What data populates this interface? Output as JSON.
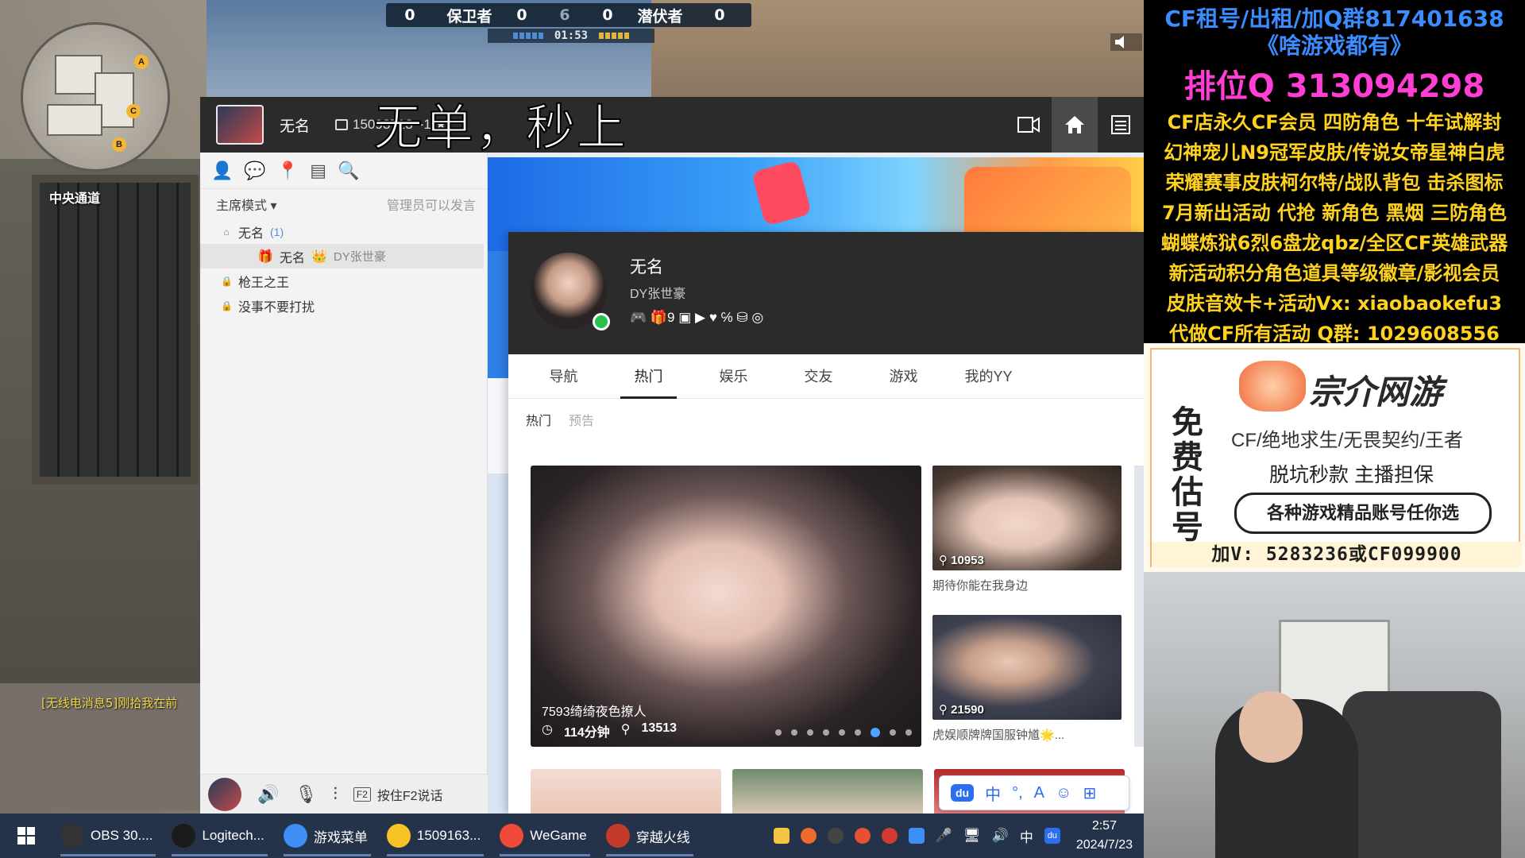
{
  "game": {
    "minimap_location": "中央通道",
    "minimap_markers": [
      "A",
      "B",
      "C"
    ],
    "killfeed": "[无线电消息5]刚拾我在前",
    "scoreboard": {
      "left_kills": "0",
      "left_team": "保卫者",
      "left_score": "0",
      "round": "6",
      "right_score": "0",
      "right_team": "潜伏者",
      "right_kills": "0"
    },
    "timer": "01:53"
  },
  "caption": "无单，秒上",
  "yy": {
    "username": "无名",
    "id_label": "15093713",
    "header_stats": "-1 ★",
    "channel": {
      "mode": "主席模式 ▾",
      "hint": "管理员可以发言",
      "tree": [
        {
          "name": "无名",
          "count": "(1)"
        },
        {
          "name": "无名",
          "tag": "DY张世豪"
        },
        {
          "name": "枪王之王"
        },
        {
          "name": "没事不要打扰"
        }
      ]
    },
    "voice_hint": "按住F2说话",
    "voice_key": "F2",
    "profile": {
      "name": "无名",
      "sub": "DY张世豪",
      "badges": "🎮 🎁9 ▣ ▶ ♥ ℅ ⛁ ◎"
    },
    "nav_tabs": [
      "导航",
      "热门",
      "娱乐",
      "交友",
      "游戏",
      "我的YY"
    ],
    "active_tab": "热门",
    "sub_tabs": [
      "热门",
      "预告"
    ],
    "feature": {
      "title": "7593绮绮夜色撩人",
      "duration": "114分钟",
      "viewers": "13513",
      "dots": 9,
      "current_dot": 6
    },
    "side_cards": [
      {
        "viewers": "10953",
        "caption": "期待你能在我身边"
      },
      {
        "viewers": "21590",
        "caption": "虎娱顺牌牌国服钟馗🌟..."
      }
    ]
  },
  "ad": {
    "lines": [
      {
        "text": "CF租号/出租/加Q群817401638",
        "color": "#3a8cff"
      },
      {
        "text": "《啥游戏都有》",
        "color": "#3a8cff"
      },
      {
        "text": "排位Q 313094298",
        "color": "#ff3ed6"
      },
      {
        "text": "CF店永久CF会员 四防角色 十年试解封",
        "color": "#ffd21f"
      },
      {
        "text": "幻神宠儿N9冠军皮肤/传说女帝星神白虎",
        "color": "#ffd21f"
      },
      {
        "text": "荣耀赛事皮肤柯尔特/战队背包 击杀图标",
        "color": "#ffd21f"
      },
      {
        "text": "7月新出活动 代抢 新角色 黑烟 三防角色",
        "color": "#ffd21f"
      },
      {
        "text": "蝴蝶炼狱6烈6盘龙qbz/全区CF英雄武器",
        "color": "#ffd21f"
      },
      {
        "text": "新活动积分角色道具等级徽章/影视会员",
        "color": "#ffd21f"
      },
      {
        "text": "皮肤音效卡+活动Vx: xiaobaokefu3",
        "color": "#ffd21f"
      },
      {
        "text": "代做CF所有活动 Q群: 1029608556",
        "color": "#ffd21f"
      }
    ]
  },
  "promo": {
    "side_text": "免费估号",
    "brand": "宗介网游",
    "line1": "CF/绝地求生/无畏契约/王者",
    "line2": "脱坑秒款   主播担保",
    "box": "各种游戏精品账号任你选",
    "contact": "加V: 5283236或CF099900"
  },
  "ime": {
    "logo": "du",
    "items": [
      "中",
      "°,",
      "A",
      "☺",
      "⊞"
    ]
  },
  "taskbar": {
    "items": [
      {
        "label": "OBS 30....",
        "color": "#333333"
      },
      {
        "label": "Logitech...",
        "color": "#1b1b1b"
      },
      {
        "label": "游戏菜单",
        "color": "#3d8ff5"
      },
      {
        "label": "1509163...",
        "color": "#f7c326"
      },
      {
        "label": "WeGame",
        "color": "#f04a3a"
      },
      {
        "label": "穿越火线",
        "color": "#c43a2a"
      }
    ],
    "tray_ime": "中",
    "time": "2:57",
    "date": "2024/7/23"
  }
}
